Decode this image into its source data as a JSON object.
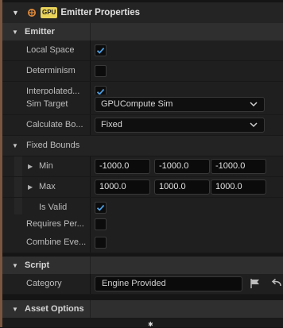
{
  "panel": {
    "title": "Emitter Properties",
    "badge": "GPU"
  },
  "sections": {
    "emitter": "Emitter",
    "script": "Script",
    "asset_options": "Asset Options"
  },
  "rows": {
    "local_space": {
      "label": "Local Space",
      "checked": true
    },
    "determinism": {
      "label": "Determinism",
      "checked": false
    },
    "interpolated": {
      "label": "Interpolated...",
      "checked": true
    },
    "sim_target": {
      "label": "Sim Target",
      "value": "GPUCompute Sim"
    },
    "calculate_bounds": {
      "label": "Calculate Bo...",
      "value": "Fixed"
    },
    "fixed_bounds": {
      "label": "Fixed Bounds"
    },
    "min": {
      "label": "Min",
      "x": "-1000.0",
      "y": "-1000.0",
      "z": "-1000.0"
    },
    "max": {
      "label": "Max",
      "x": "1000.0",
      "y": "1000.0",
      "z": "1000.0"
    },
    "is_valid": {
      "label": "Is Valid",
      "checked": true
    },
    "requires_persistent": {
      "label": "Requires Per...",
      "checked": false
    },
    "combine_event": {
      "label": "Combine Eve...",
      "checked": false
    },
    "category": {
      "label": "Category",
      "value": "Engine Provided"
    }
  },
  "icons": {
    "collapse": "triangle-down-icon",
    "expand": "triangle-right-icon",
    "check": "checkmark-icon",
    "dropdown": "chevron-down-icon",
    "flag": "flag-icon",
    "reset": "reset-arrow-icon"
  },
  "colors": {
    "check": "#4d9de0",
    "badge": "#e8d25a",
    "accent": "#7a5540",
    "header_icon": "#e08a3a"
  }
}
